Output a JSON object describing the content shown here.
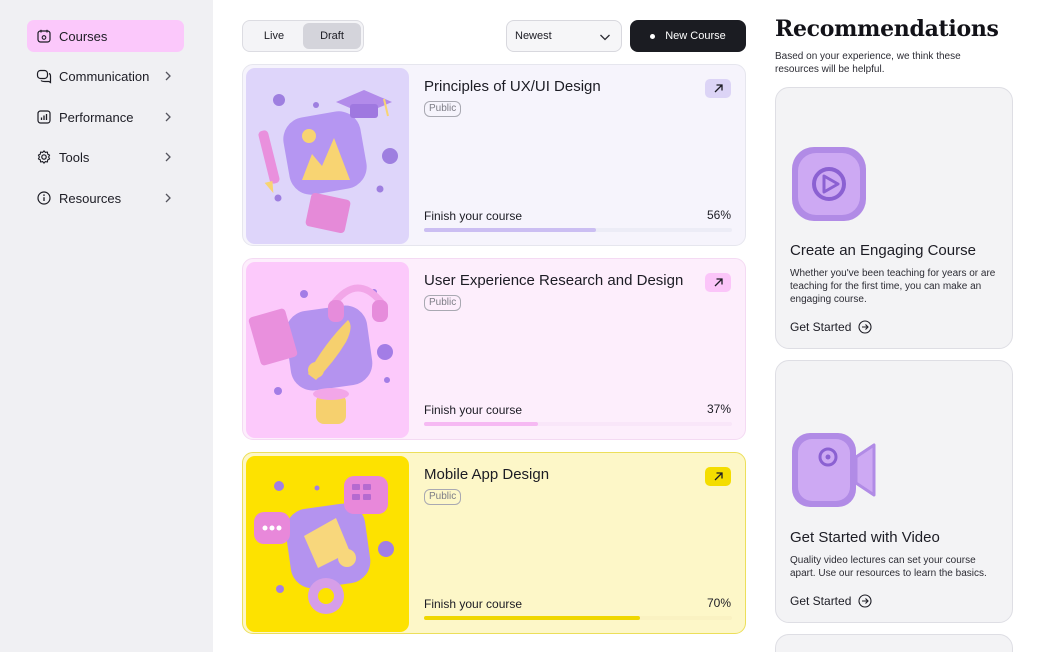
{
  "sidebar": {
    "items": [
      {
        "label": "Courses",
        "icon": "calendar-icon",
        "active": true
      },
      {
        "label": "Communication",
        "icon": "chat-icon",
        "active": false
      },
      {
        "label": "Performance",
        "icon": "chart-icon",
        "active": false
      },
      {
        "label": "Tools",
        "icon": "gear-icon",
        "active": false
      },
      {
        "label": "Resources",
        "icon": "info-icon",
        "active": false
      }
    ]
  },
  "toolbar": {
    "tabs": [
      {
        "label": "Live",
        "selected": false
      },
      {
        "label": "Draft",
        "selected": true
      }
    ],
    "sort": {
      "value": "Newest"
    },
    "new_course_label": "New Course"
  },
  "courses": [
    {
      "title": "Principles of UX/UI Design",
      "badge": "Public",
      "progress_label": "Finish your course",
      "progress_text": "56%",
      "progress": 0.56,
      "accent": "#ded5fa"
    },
    {
      "title": "User Experience Research and Design",
      "badge": "Public",
      "progress_label": "Finish your course",
      "progress_text": "37%",
      "progress": 0.37,
      "accent": "#fcc9fb"
    },
    {
      "title": "Mobile App Design",
      "badge": "Public",
      "progress_label": "Finish your course",
      "progress_text": "70%",
      "progress": 0.7,
      "accent": "#fde200"
    }
  ],
  "recommendations": {
    "title": "Recommendations",
    "subtitle": "Based on your experience, we think these resources will be helpful.",
    "cards": [
      {
        "title": "Create an Engaging Course",
        "description": "Whether you've been teaching for years or are teaching for the first time, you can make an engaging course.",
        "link": "Get Started",
        "icon": "play-icon"
      },
      {
        "title": "Get Started with Video",
        "description": "Quality video lectures can set your course apart. Use our resources to learn the basics.",
        "link": "Get Started",
        "icon": "video-camera-icon"
      }
    ]
  }
}
